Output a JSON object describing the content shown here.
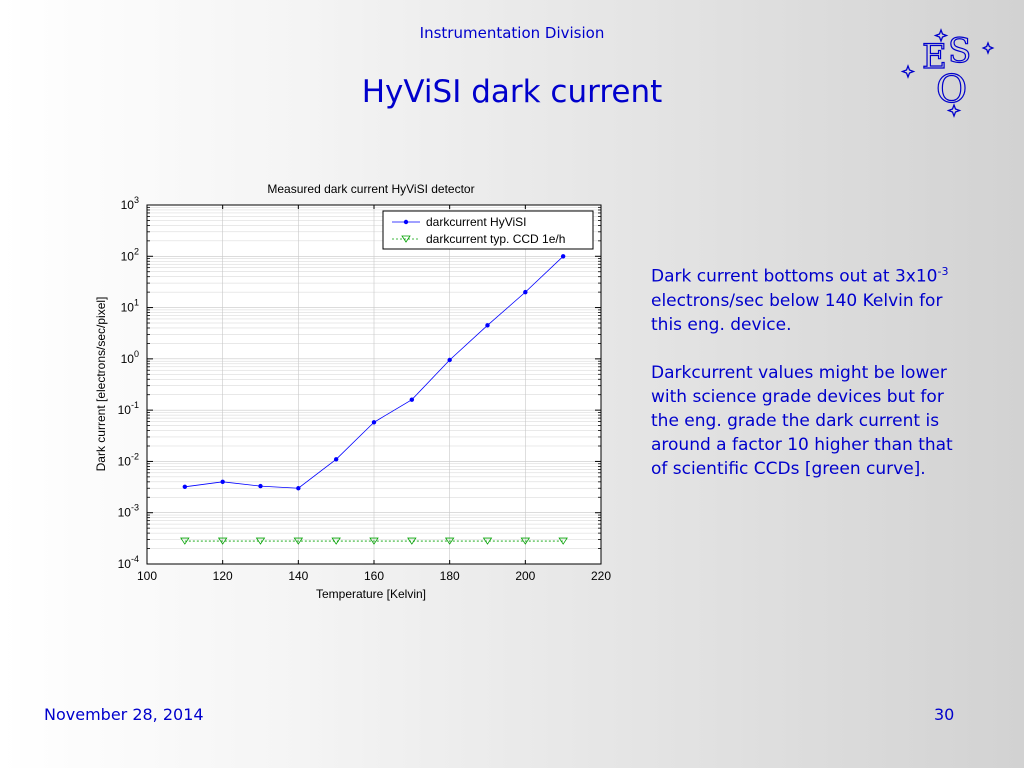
{
  "header": {
    "division": "Instrumentation Division",
    "title": "HyViSI dark current"
  },
  "logo": {
    "letters": [
      "E",
      "S",
      "O"
    ]
  },
  "description": {
    "p1_before": "Dark current bottoms out at 3x10",
    "p1_exp": "-3",
    "p1_after": " electrons/sec below 140 Kelvin for this eng. device.",
    "p2": "Darkcurrent values might be lower with science grade devices but for the eng. grade the dark current is around a factor 10 higher than that of scientific CCDs [green curve]."
  },
  "footer": {
    "date": "November 28, 2014",
    "page": "30"
  },
  "colors": {
    "text": "#0000cc",
    "series1": "#0000ff",
    "series2": "#00a000"
  },
  "chart_data": {
    "type": "line",
    "title": "Measured dark current HyViSI detector",
    "xlabel": "Temperature [Kelvin]",
    "ylabel": "Dark current [electrons/sec/pixel]",
    "xlim": [
      100,
      220
    ],
    "ylim": [
      0.0001,
      1000
    ],
    "yscale": "log",
    "xticks": [
      100,
      120,
      140,
      160,
      180,
      200,
      220
    ],
    "yticks": [
      -4,
      -3,
      -2,
      -1,
      0,
      1,
      2,
      3
    ],
    "grid": true,
    "legend_position": "top-right",
    "series": [
      {
        "name": "darkcurrent HyViSI",
        "color": "#0000ff",
        "marker": "dot",
        "x": [
          110,
          120,
          130,
          140,
          150,
          160,
          170,
          180,
          190,
          200,
          210
        ],
        "y": [
          0.0032,
          0.004,
          0.0033,
          0.003,
          0.011,
          0.058,
          0.16,
          0.95,
          4.5,
          20,
          100
        ]
      },
      {
        "name": "darkcurrent typ. CCD 1e/h",
        "color": "#00a000",
        "marker": "triangle",
        "x": [
          110,
          120,
          130,
          140,
          150,
          160,
          170,
          180,
          190,
          200,
          210
        ],
        "y": [
          0.00028,
          0.00028,
          0.00028,
          0.00028,
          0.00028,
          0.00028,
          0.00028,
          0.00028,
          0.00028,
          0.00028,
          0.00028
        ]
      }
    ]
  }
}
